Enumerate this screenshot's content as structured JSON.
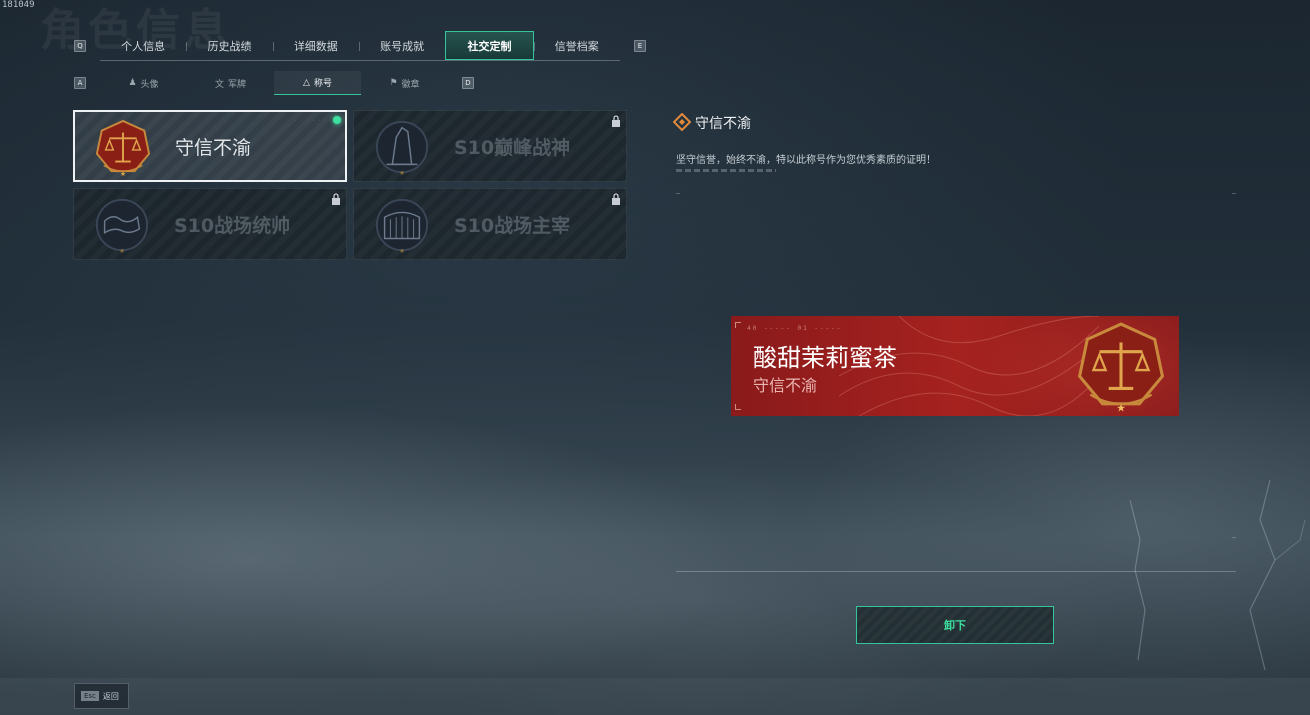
{
  "build_id": "181049",
  "background_title": "角色信息",
  "top_tabs": [
    {
      "label": "个人信息"
    },
    {
      "label": "历史战绩"
    },
    {
      "label": "详细数据"
    },
    {
      "label": "账号成就"
    },
    {
      "label": "社交定制"
    },
    {
      "label": "信誉档案"
    }
  ],
  "top_tabs_active_index": 4,
  "key_hints": {
    "prev_top": "Q",
    "next_top": "E",
    "prev_sub": "A",
    "next_sub": "D"
  },
  "sub_tabs": [
    {
      "label": "头像",
      "icon": "person-icon"
    },
    {
      "label": "军牌",
      "icon": "dogtag-icon"
    },
    {
      "label": "称号",
      "icon": "title-icon"
    },
    {
      "label": "徽章",
      "icon": "badge-icon"
    }
  ],
  "sub_tabs_active_index": 2,
  "titles": [
    {
      "name": "守信不渝",
      "emblem": "scales-emblem",
      "state": "equipped",
      "locked": false
    },
    {
      "name": "S10巅峰战神",
      "emblem": "statue-emblem",
      "state": "locked",
      "locked": true
    },
    {
      "name": "S10战场统帅",
      "emblem": "map-emblem",
      "state": "locked",
      "locked": true
    },
    {
      "name": "S10战场主宰",
      "emblem": "colosseum-emblem",
      "state": "locked",
      "locked": true
    }
  ],
  "detail": {
    "title": "守信不渝",
    "description": "坚守信誉，始终不渝，特以此称号作为您优秀素质的证明！"
  },
  "preview_banner": {
    "player_name": "酸甜茉莉蜜茶",
    "title": "守信不渝",
    "code_text": "40 ----- 01 -----",
    "color": "#a5221f"
  },
  "actions": {
    "unequip_label": "卸下"
  },
  "footer": {
    "esc_key": "Esc",
    "back_label": "返回"
  },
  "colors": {
    "accent": "#35c59a",
    "equipped_dot": "#3ee0a0"
  }
}
